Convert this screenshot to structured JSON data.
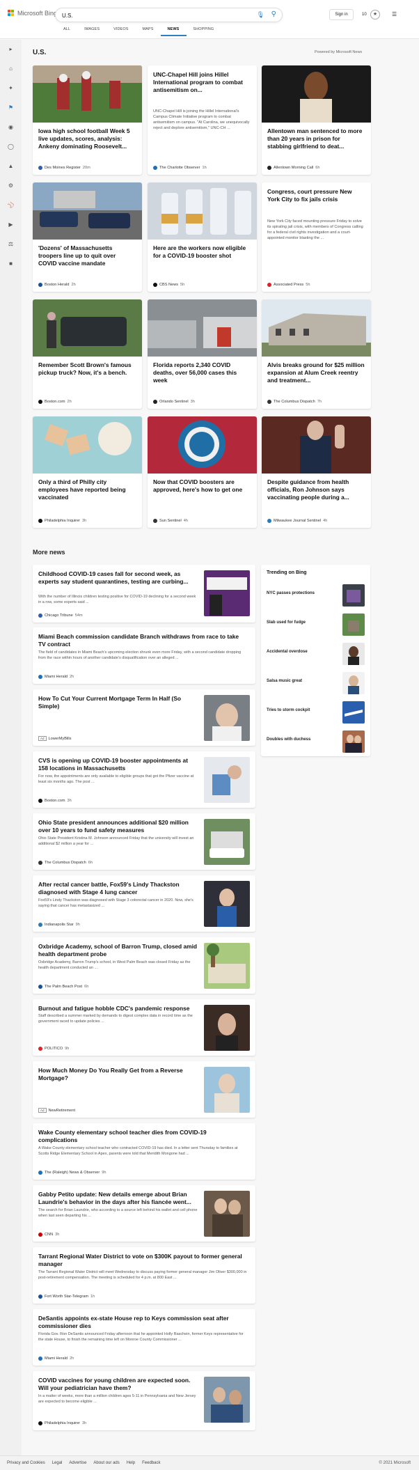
{
  "header": {
    "brand": "Microsoft Bing",
    "search_value": "U.S.",
    "signin_label": "Sign in",
    "rewards_count": "10",
    "tabs": [
      {
        "label": "ALL"
      },
      {
        "label": "IMAGES"
      },
      {
        "label": "VIDEOS"
      },
      {
        "label": "MAPS"
      },
      {
        "label": "NEWS"
      },
      {
        "label": "SHOPPING"
      }
    ]
  },
  "left_rail": {
    "icons": [
      "expand-icon",
      "home-icon",
      "discover-icon",
      "flag-icon",
      "location-icon",
      "globe-icon",
      "business-icon",
      "science-icon",
      "sports-icon",
      "entertainment-icon",
      "politics-icon",
      "lifestyle-icon"
    ]
  },
  "top_section": {
    "title": "U.S.",
    "powered_by": "Powered by Microsoft News",
    "cards": [
      {
        "title": "Iowa high school football Week 5 live updates, scores, analysis: Ankeny dominating Roosevelt...",
        "snippet": "",
        "source": "Des Moines Register",
        "time": "20m",
        "logo_color": "#2e5fa8"
      },
      {
        "title": "UNC-Chapel Hill joins Hillel International program to combat antisemitism on...",
        "snippet": "UNC-Chapel Hill is joining the Hillel International's Campus Climate Initiative program to combat antisemitism on campus. \"At Carolina, we unequivocally reject and deplore antisemitism,\" UNC-CH ...",
        "source": "The Charlotte Observer",
        "time": "1h",
        "logo_color": "#1d6fb8"
      },
      {
        "title": "Allentown man sentenced to more than 20 years in prison for stabbing girlfriend to deat...",
        "snippet": "",
        "source": "Allentown Morning Call",
        "time": "6h",
        "logo_color": "#222222"
      },
      {
        "title": "'Dozens' of Massachusetts troopers line up to quit over COVID vaccine mandate",
        "snippet": "",
        "source": "Boston Herald",
        "time": "2h",
        "logo_color": "#1b4f9c"
      },
      {
        "title": "Here are the workers now eligible for a COVID-19 booster shot",
        "snippet": "",
        "source": "CBS News",
        "time": "5h",
        "logo_color": "#111111"
      },
      {
        "title": "Congress, court pressure New York City to fix jails crisis",
        "snippet": "New York City faced mounting pressure Friday to solve its spiraling jail crisis, with members of Congress calling for a federal civil rights investigation and a court-appointed monitor blasting the ...",
        "source": "Associated Press",
        "time": "5h",
        "logo_color": "#d6252b"
      },
      {
        "title": "Remember Scott Brown's famous pickup truck? Now, it's a bench.",
        "snippet": "",
        "source": "Boston.com",
        "time": "2h",
        "logo_color": "#111111"
      },
      {
        "title": "Florida reports 2,340 COVID deaths, over 56,000 cases this week",
        "snippet": "",
        "source": "Orlando Sentinel",
        "time": "3h",
        "logo_color": "#222222"
      },
      {
        "title": "Alvis breaks ground for $25 million expansion at Alum Creek reentry and treatment...",
        "snippet": "",
        "source": "The Columbus Dispatch",
        "time": "7h",
        "logo_color": "#333333"
      },
      {
        "title": "Only a third of Philly city employees have reported being vaccinated",
        "snippet": "",
        "source": "Philadelphia Inquirer",
        "time": "3h",
        "logo_color": "#111111"
      },
      {
        "title": "Now that COVID boosters are approved, here's how to get one",
        "snippet": "",
        "source": "Sun Sentinel",
        "time": "4h",
        "logo_color": "#333333"
      },
      {
        "title": "Despite guidance from health officials, Ron Johnson says vaccinating people during a...",
        "snippet": "",
        "source": "Milwaukee Journal Sentinel",
        "time": "4h",
        "logo_color": "#2a7ab8"
      }
    ]
  },
  "more_news": {
    "title": "More news",
    "items": [
      {
        "title": "Childhood COVID-19 cases fall for second week, as experts say student quarantines, testing are curbing...",
        "snippet": "With the number of Illinois children testing positive for COVID-19 declining for a second week in a row, some experts said ...",
        "source": "Chicago Tribune",
        "time": "54m",
        "ad": "",
        "logo_color": "#2e5fa8"
      },
      {
        "title": "Miami Beach commission candidate Branch withdraws from race to take TV contract",
        "snippet": "The field of candidates in Miami Beach's upcoming election shrunk even more Friday, with a second candidate dropping from the race within hours of another candidate's disqualification over an alleged ...",
        "source": "Miami Herald",
        "time": "2h",
        "ad": "",
        "logo_color": "#1d6fb8"
      },
      {
        "title": "How To Cut Your Current Mortgage Term In Half (So Simple)",
        "snippet": "",
        "source": "LowerMyBills",
        "time": "",
        "ad": "Ad",
        "logo_color": ""
      },
      {
        "title": "CVS is opening up COVID-19 booster appointments at 158 locations in Massachusetts",
        "snippet": "For now, the appointments are only available to eligible groups that got the Pfizer vaccine at least six months ago. The post ...",
        "source": "Boston.com",
        "time": "3h",
        "ad": "",
        "logo_color": "#111111"
      },
      {
        "title": "Ohio State president announces additional $20 million over 10 years to fund safety measures",
        "snippet": "Ohio State President Kristina M. Johnson announced Friday that the university will invest an additional $2 million a year for ...",
        "source": "The Columbus Dispatch",
        "time": "6h",
        "ad": "",
        "logo_color": "#333333"
      },
      {
        "title": "After rectal cancer battle, Fox59's Lindy Thackston diagnosed with Stage 4 lung cancer",
        "snippet": "Fox59's Lindy Thackston was diagnosed with Stage 3 colorectal cancer in 2020. Now, she's saying that cancer has metastasized ...",
        "source": "Indianapolis Star",
        "time": "9h",
        "ad": "",
        "logo_color": "#2a7ab8"
      },
      {
        "title": "Oxbridge Academy, school of Barron Trump, closed amid health department probe",
        "snippet": "Oxbridge Academy, Barron Trump's school, in West Palm Beach was closed Friday as the health department conducted an ...",
        "source": "The Palm Beach Post",
        "time": "6h",
        "ad": "",
        "logo_color": "#1b4f9c"
      },
      {
        "title": "Burnout and fatigue hobble CDC's pandemic response",
        "snippet": "Staff described a summer marked by demands to digest complex data in record time as the government raced to update policies ...",
        "source": "POLITICO",
        "time": "9h",
        "ad": "",
        "logo_color": "#d6252b"
      },
      {
        "title": "How Much Money Do You Really Get from a Reverse Mortgage?",
        "snippet": "",
        "source": "NewRetirement",
        "time": "",
        "ad": "Ad",
        "logo_color": ""
      },
      {
        "title": "Wake County elementary school teacher dies from COVID-19 complications",
        "snippet": "A Wake County elementary school teacher who contracted COVID-19 has died. In a letter sent Thursday to families at Scotts Ridge Elementary School in Apex, parents were told that Meridith Mongone had ...",
        "source": "The (Raleigh) News & Observer",
        "time": "9h",
        "ad": "",
        "logo_color": "#1d6fb8"
      },
      {
        "title": "Gabby Petito update: New details emerge about Brian Laundrie's behavior in the days after his fiancée went...",
        "snippet": "The search for Brian Laundrie, who according to a source left behind his wallet and cell phone when last seen departing his ...",
        "source": "CNN",
        "time": "3h",
        "ad": "",
        "logo_color": "#cc0000"
      },
      {
        "title": "Tarrant Regional Water District to vote on $300K payout to former general manager",
        "snippet": "The Tarrant Regional Water District will meet Wednesday to discuss paying former general manager Jim Oliver $300,000 in post-retirement compensation. The meeting is scheduled for 4 p.m. at 800 East ...",
        "source": "Fort Worth Star-Telegram",
        "time": "1h",
        "ad": "",
        "logo_color": "#1b4f9c"
      },
      {
        "title": "DeSantis appoints ex-state House rep to Keys commission seat after commissioner dies",
        "snippet": "Florida Gov. Ron DeSantis announced Friday afternoon that he appointed Holly Raschein, former Keys representative for the state House, to finish the remaining time left on Monroe County Commissioner ...",
        "source": "Miami Herald",
        "time": "2h",
        "ad": "",
        "logo_color": "#1d6fb8"
      },
      {
        "title": "COVID vaccines for young children are expected soon. Will your pediatrician have them?",
        "snippet": "In a matter of weeks, more than a million children ages 5-11 in Pennsylvania and New Jersey are expected to become eligible ...",
        "source": "Philadelphia Inquirer",
        "time": "3h",
        "ad": "",
        "logo_color": "#111111"
      }
    ]
  },
  "trending": {
    "title": "Trending on Bing",
    "items": [
      {
        "label": "NYC passes protections"
      },
      {
        "label": "Slab used for fudge"
      },
      {
        "label": "Accidental overdose"
      },
      {
        "label": "Salsa music great"
      },
      {
        "label": "Tries to storm cockpit"
      },
      {
        "label": "Doubles with duchess"
      }
    ]
  },
  "footer": {
    "links": [
      "Privacy and Cookies",
      "Legal",
      "Advertise",
      "About our ads",
      "Help",
      "Feedback"
    ],
    "copyright": "© 2021 Microsoft"
  },
  "colors": {
    "accent": "#2f7ec4",
    "ms_red": "#f25022",
    "ms_green": "#7fba00",
    "ms_blue": "#00a4ef",
    "ms_yellow": "#ffb900"
  }
}
